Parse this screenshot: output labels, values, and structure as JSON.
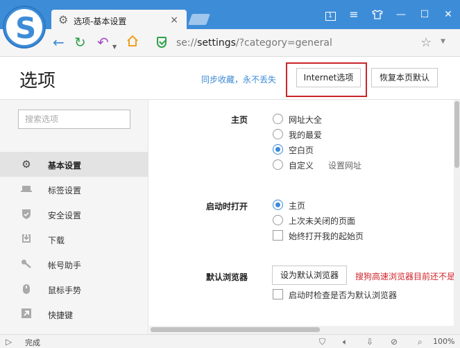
{
  "browser": {
    "tab_title": "选项-基本设置",
    "tab_close": "×",
    "url_scheme": "se://",
    "url_host": "settings",
    "url_rest": "/?category=general",
    "window_controls": [
      "1",
      "≡",
      "shirt-icon",
      "—",
      "☐",
      "✕"
    ]
  },
  "page": {
    "title": "选项",
    "sync_link": "同步收藏，永不丢失",
    "internet_options_button": "Internet选项",
    "restore_defaults_button": "恢复本页默认"
  },
  "sidebar": {
    "search_placeholder": "搜索选项",
    "items": [
      {
        "label": "基本设置",
        "icon": "gear-icon",
        "active": true
      },
      {
        "label": "标签设置",
        "icon": "tab-icon"
      },
      {
        "label": "安全设置",
        "icon": "shield-icon"
      },
      {
        "label": "下载",
        "icon": "download-icon"
      },
      {
        "label": "帐号助手",
        "icon": "key-icon"
      },
      {
        "label": "鼠标手势",
        "icon": "mouse-icon"
      },
      {
        "label": "快捷键",
        "icon": "arrow-icon"
      }
    ]
  },
  "settings": {
    "homepage": {
      "label": "主页",
      "options": [
        "网址大全",
        "我的最爱",
        "空白页",
        "自定义"
      ],
      "selected": "空白页",
      "set_url_link": "设置网址"
    },
    "startup": {
      "label": "启动时打开",
      "options": [
        "主页",
        "上次未关闭的页面"
      ],
      "selected": "主页",
      "checkbox": "始终打开我的起始页"
    },
    "default_browser": {
      "label": "默认浏览器",
      "button": "设为默认浏览器",
      "warning": "搜狗高速浏览器目前还不是",
      "checkbox": "启动时检查是否为默认浏览器"
    }
  },
  "statusbar": {
    "status": "完成",
    "zoom": "100%"
  },
  "colors": {
    "accent": "#3d8cd8",
    "link": "#3b8ad6",
    "highlight_border": "#c8252b",
    "warning": "#d0252b"
  }
}
